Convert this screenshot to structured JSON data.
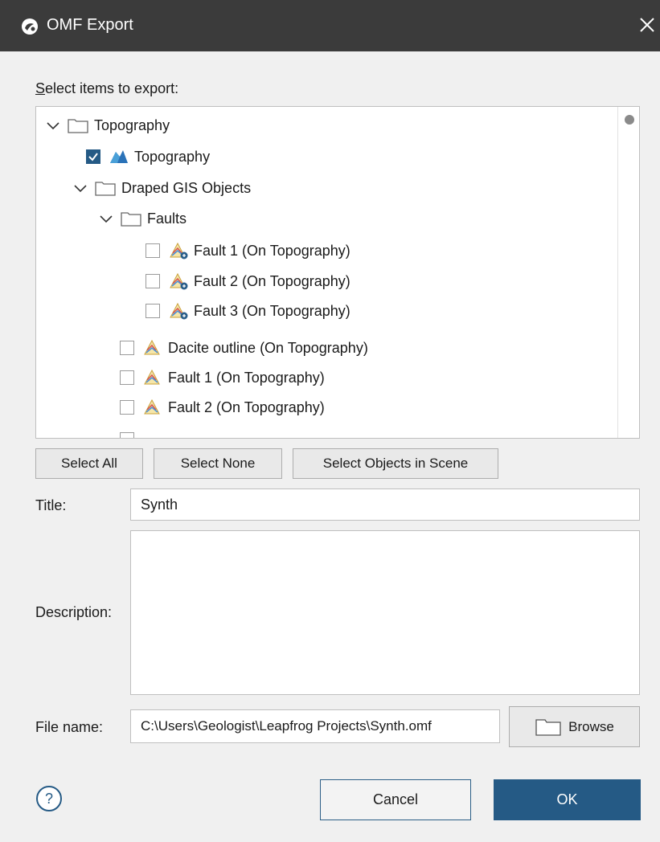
{
  "window": {
    "title": "OMF Export"
  },
  "tree": {
    "label": "Select items to export:",
    "rows": [
      {
        "text": "Topography"
      },
      {
        "text": "Topography"
      },
      {
        "text": "Draped GIS Objects"
      },
      {
        "text": "Faults"
      },
      {
        "text": "Fault 1 (On Topography)"
      },
      {
        "text": "Fault 2 (On Topography)"
      },
      {
        "text": "Fault 3 (On Topography)"
      },
      {
        "text": "Dacite outline (On Topography)"
      },
      {
        "text": "Fault 1 (On Topography)"
      },
      {
        "text": "Fault 2 (On Topography)"
      }
    ]
  },
  "buttons": {
    "select_all": "Select All",
    "select_none": "Select None",
    "select_scene": "Select Objects in Scene",
    "browse": "Browse",
    "cancel": "Cancel",
    "ok": "OK"
  },
  "form": {
    "title_label": "Title:",
    "title_value": "Synth",
    "description_label": "Description:",
    "description_value": "",
    "file_label": "File name:",
    "file_value": "C:\\Users\\Geologist\\Leapfrog Projects\\Synth.omf"
  },
  "colors": {
    "titlebar": "#3b3b3b",
    "accent": "#255a85",
    "background": "#f0f0f0"
  },
  "icons": [
    "app-icon",
    "close-icon",
    "chevron-down-icon",
    "folder-icon",
    "surface-icon",
    "gis-line-icon",
    "help-icon"
  ]
}
